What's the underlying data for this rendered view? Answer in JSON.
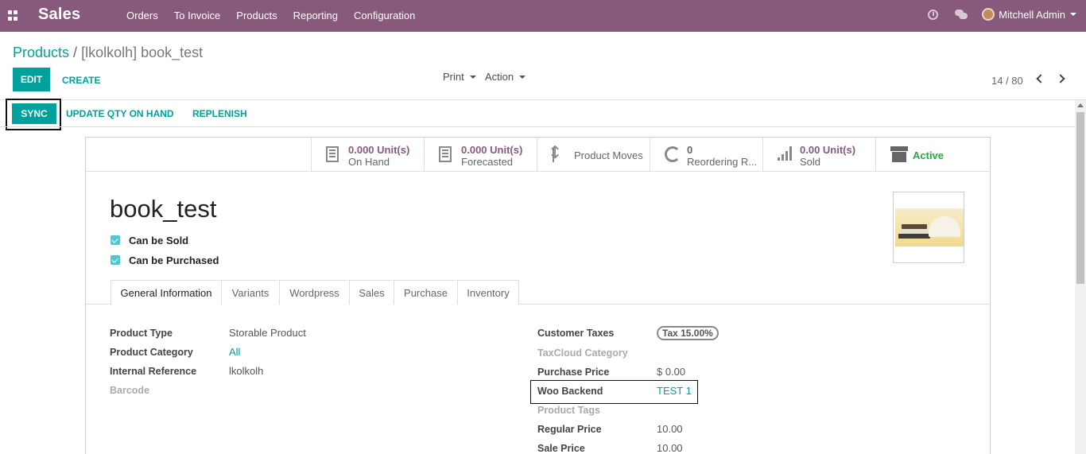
{
  "navbar": {
    "app_title": "Sales",
    "menu": [
      "Orders",
      "To Invoice",
      "Products",
      "Reporting",
      "Configuration"
    ],
    "user_name": "Mitchell Admin"
  },
  "control": {
    "breadcrumb_root": "Products",
    "breadcrumb_sep": "/",
    "breadcrumb_current": "[lkolkolh] book_test",
    "edit_label": "EDIT",
    "create_label": "CREATE",
    "print_label": "Print",
    "action_label": "Action",
    "pager": "14 / 80"
  },
  "statusbar": {
    "sync_label": "SYNC",
    "update_qty_label": "UPDATE QTY ON HAND",
    "replenish_label": "REPLENISH"
  },
  "smart_buttons": {
    "on_hand_value": "0.000 Unit(s)",
    "on_hand_label": "On Hand",
    "forecasted_value": "0.000 Unit(s)",
    "forecasted_label": "Forecasted",
    "moves_label": "Product Moves",
    "reordering_value": "0",
    "reordering_label": "Reordering R...",
    "sold_value": "0.00 Unit(s)",
    "sold_label": "Sold",
    "active_label": "Active"
  },
  "product": {
    "name": "book_test",
    "can_be_sold": "Can be Sold",
    "can_be_purchased": "Can be Purchased"
  },
  "tabs": [
    "General Information",
    "Variants",
    "Wordpress",
    "Sales",
    "Purchase",
    "Inventory"
  ],
  "left_fields": {
    "type_label": "Product Type",
    "type_value": "Storable Product",
    "category_label": "Product Category",
    "category_value": "All",
    "ref_label": "Internal Reference",
    "ref_value": "lkolkolh",
    "barcode_label": "Barcode"
  },
  "right_fields": {
    "customer_taxes_label": "Customer Taxes",
    "customer_taxes_value": "Tax 15.00%",
    "taxcloud_label": "TaxCloud Category",
    "purchase_price_label": "Purchase Price",
    "purchase_price_value": "$ 0.00",
    "woo_backend_label": "Woo Backend",
    "woo_backend_value": "TEST 1",
    "product_tags_label": "Product Tags",
    "regular_price_label": "Regular Price",
    "regular_price_value": "10.00",
    "sale_price_label": "Sale Price",
    "sale_price_value": "10.00"
  },
  "colors": {
    "navbar": "#875a7b",
    "primary": "#00a09d",
    "smart_value": "#875a7b",
    "active": "#28a745"
  }
}
